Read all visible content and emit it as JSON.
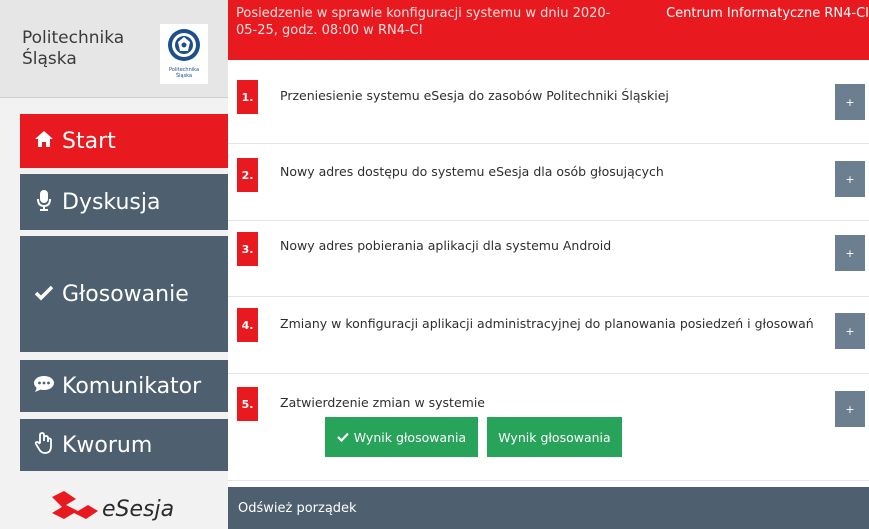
{
  "organization": {
    "name_line1": "Politechnika",
    "name_line2": "Śląska",
    "logo_text_line1": "Politechnika",
    "logo_text_line2": "Śląska"
  },
  "sidebar": {
    "items": [
      {
        "label": "Start",
        "icon": "home-icon",
        "active": true
      },
      {
        "label": "Dyskusja",
        "icon": "microphone-icon",
        "active": false
      },
      {
        "label": "Głosowanie",
        "icon": "checkmark-icon",
        "active": false
      },
      {
        "label": "Komunikator",
        "icon": "chat-bubble-icon",
        "active": false
      },
      {
        "label": "Kworum",
        "icon": "hand-icon",
        "active": false
      }
    ]
  },
  "app_logo": {
    "name": "eSesja"
  },
  "header": {
    "meeting_title": "Posiedzenie w sprawie konfiguracji systemu w dniu 2020-05-25, godz. 08:00 w RN4-CI",
    "center_name": "Centrum Informatyczne RN4-CI"
  },
  "agenda": {
    "items": [
      {
        "number": "1.",
        "title": "Przeniesienie systemu eSesja do zasobów Politechniki Śląskiej",
        "expand_label": "+"
      },
      {
        "number": "2.",
        "title": "Nowy adres dostępu do systemu eSesja dla osób głosujących",
        "expand_label": "+"
      },
      {
        "number": "3.",
        "title": "Nowy adres pobierania aplikacji dla systemu Android",
        "expand_label": "+"
      },
      {
        "number": "4.",
        "title": "Zmiany w konfiguracji aplikacji administracyjnej do planowania posiedzeń i głosowań",
        "expand_label": "+"
      },
      {
        "number": "5.",
        "title": "Zatwierdzenie zmian w systemie",
        "expand_label": "+"
      }
    ],
    "vote_buttons": [
      {
        "label": "Wynik głosowania",
        "icon": "checkmark-icon"
      },
      {
        "label": "Wynik głosowania"
      }
    ]
  },
  "footer": {
    "refresh_label": "Odśwież porządek"
  },
  "colors": {
    "accent_red": "#e8191f",
    "nav_slate": "#4e6070",
    "expand_button": "#6b7f90",
    "vote_green": "#27a35a"
  }
}
